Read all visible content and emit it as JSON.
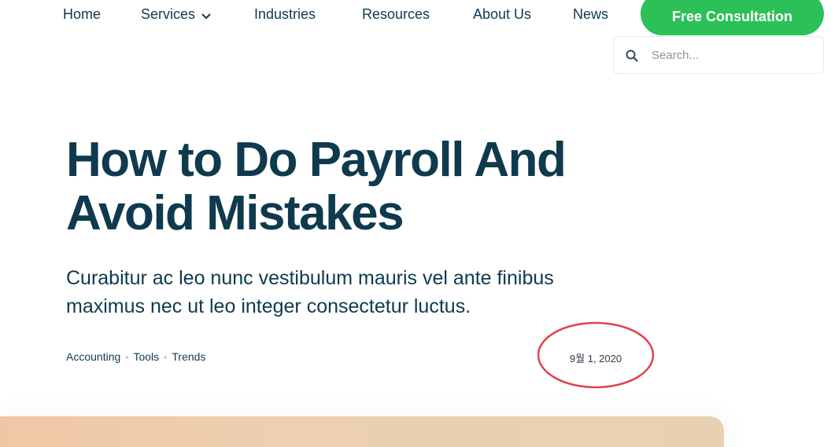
{
  "nav": {
    "items": [
      {
        "label": "Home"
      },
      {
        "label": "Services"
      },
      {
        "label": "Industries"
      },
      {
        "label": "Resources"
      },
      {
        "label": "About Us"
      },
      {
        "label": "News"
      }
    ],
    "cta_label": "Free Consultation"
  },
  "search": {
    "placeholder": "Search..."
  },
  "article": {
    "title": "How to Do Payroll And Avoid Mistakes",
    "excerpt": "Curabitur ac leo nunc vestibulum mauris vel ante finibus maximus nec ut leo integer consectetur luctus.",
    "tags": [
      "Accounting",
      "Tools",
      "Trends"
    ],
    "tag_separator": "•",
    "date": "9월 1, 2020"
  },
  "colors": {
    "brand_dark": "#0f3a4e",
    "cta_green": "#2cc058",
    "annotation_red": "#e0424a",
    "featured_bg": "#ecd0b0"
  },
  "icons": {
    "services_dropdown": "chevron-down-icon",
    "search": "search-icon"
  }
}
